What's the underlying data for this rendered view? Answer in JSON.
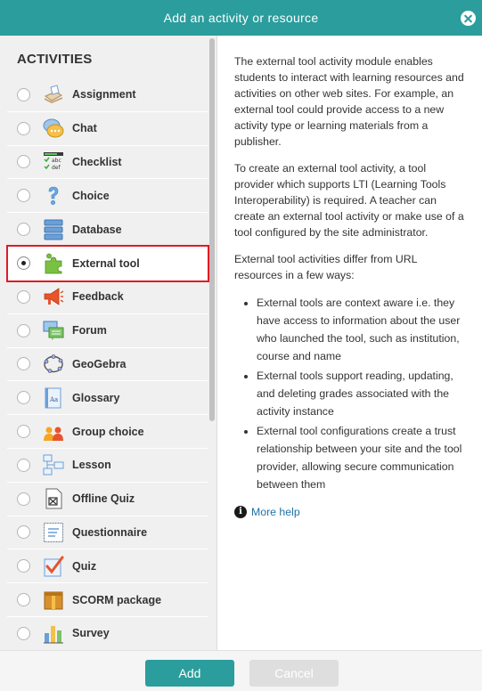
{
  "dialog": {
    "title": "Add an activity or resource"
  },
  "sidebar": {
    "heading": "ACTIVITIES",
    "items": [
      {
        "label": "Assignment",
        "icon": "assignment-icon",
        "selected": false
      },
      {
        "label": "Chat",
        "icon": "chat-icon",
        "selected": false
      },
      {
        "label": "Checklist",
        "icon": "checklist-icon",
        "selected": false
      },
      {
        "label": "Choice",
        "icon": "choice-icon",
        "selected": false
      },
      {
        "label": "Database",
        "icon": "database-icon",
        "selected": false
      },
      {
        "label": "External tool",
        "icon": "external-tool-icon",
        "selected": true
      },
      {
        "label": "Feedback",
        "icon": "feedback-icon",
        "selected": false
      },
      {
        "label": "Forum",
        "icon": "forum-icon",
        "selected": false
      },
      {
        "label": "GeoGebra",
        "icon": "geogebra-icon",
        "selected": false
      },
      {
        "label": "Glossary",
        "icon": "glossary-icon",
        "selected": false
      },
      {
        "label": "Group choice",
        "icon": "group-choice-icon",
        "selected": false
      },
      {
        "label": "Lesson",
        "icon": "lesson-icon",
        "selected": false
      },
      {
        "label": "Offline Quiz",
        "icon": "offline-quiz-icon",
        "selected": false
      },
      {
        "label": "Questionnaire",
        "icon": "questionnaire-icon",
        "selected": false
      },
      {
        "label": "Quiz",
        "icon": "quiz-icon",
        "selected": false
      },
      {
        "label": "SCORM package",
        "icon": "scorm-package-icon",
        "selected": false
      },
      {
        "label": "Survey",
        "icon": "survey-icon",
        "selected": false
      }
    ]
  },
  "help": {
    "para1": "The external tool activity module enables students to interact with learning resources and activities on other web sites. For example, an external tool could provide access to a new activity type or learning materials from a publisher.",
    "para2": "To create an external tool activity, a tool provider which supports LTI (Learning Tools Interoperability) is required. A teacher can create an external tool activity or make use of a tool configured by the site administrator.",
    "para3": "External tool activities differ from URL resources in a few ways:",
    "bullets": [
      "External tools are context aware i.e. they have access to information about the user who launched the tool, such as institution, course and name",
      "External tools support reading, updating, and deleting grades associated with the activity instance",
      "External tool configurations create a trust relationship between your site and the tool provider, allowing secure communication between them"
    ],
    "more_help": "More help"
  },
  "footer": {
    "add_label": "Add",
    "cancel_label": "Cancel"
  },
  "colors": {
    "accent": "#2a9d9c",
    "selection_border": "#e01b24",
    "link": "#1f72a8"
  }
}
